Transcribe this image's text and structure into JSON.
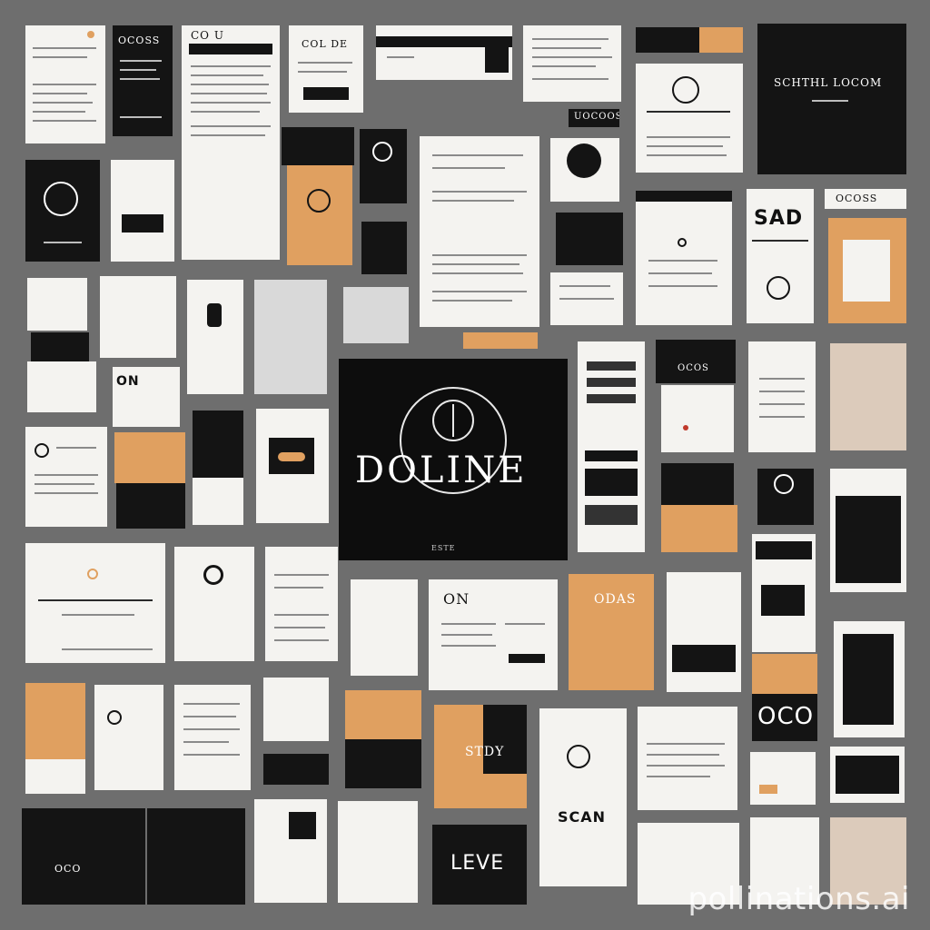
{
  "hero": {
    "title": "DOLINE",
    "caption": "ESTE"
  },
  "labels": {
    "c1": "OCOSS",
    "c2": "CO U",
    "c3": "COL DE",
    "c4": "SCHTHL LOCOM",
    "c5": "UOCOOS",
    "c6": "SAD",
    "c7": "OCOSS",
    "c8": "OCOS",
    "c9": "ON",
    "c10": "OCO",
    "c11": "LEVE",
    "c12": "SCAN",
    "c13": "STDY",
    "c14": "ON",
    "c15": "ODAS",
    "c16": "OCO"
  },
  "watermark": "pollinations.ai",
  "colors": {
    "background": "#6e6e6e",
    "accent": "#e0a060",
    "dark": "#141414",
    "paper": "#f4f3f0"
  }
}
